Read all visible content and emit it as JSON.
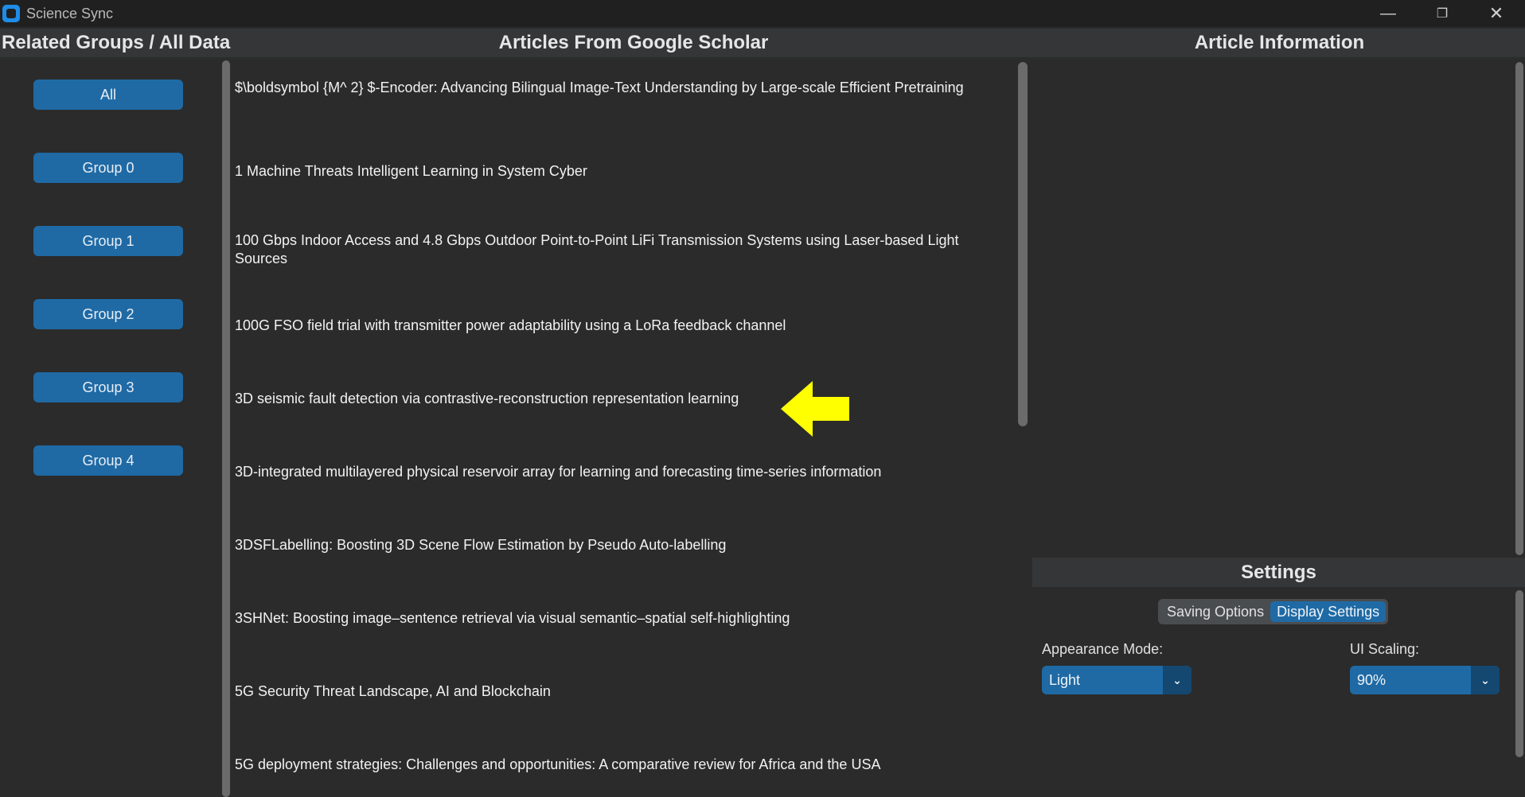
{
  "window": {
    "title": "Science Sync",
    "minimize_glyph": "—",
    "maximize_glyph": "❐",
    "close_glyph": "✕"
  },
  "panels": {
    "left_title": "Related Groups / All Data",
    "middle_title": "Articles From Google Scholar",
    "right_title": "Article Information"
  },
  "groups": [
    {
      "label": "All"
    },
    {
      "label": "Group 0"
    },
    {
      "label": "Group 1"
    },
    {
      "label": "Group 2"
    },
    {
      "label": "Group 3"
    },
    {
      "label": "Group 4"
    }
  ],
  "articles": [
    {
      "title": "$\\boldsymbol {M^ 2} $-Encoder: Advancing Bilingual Image-Text Understanding by Large-scale Efficient Pretraining"
    },
    {
      "title": "1 Machine Threats Intelligent Learning in System Cyber"
    },
    {
      "title": "100 Gbps Indoor Access and 4.8 Gbps Outdoor Point-to-Point LiFi Transmission Systems using Laser-based Light Sources"
    },
    {
      "title": "100G FSO field trial with transmitter power adaptability using a LoRa feedback channel"
    },
    {
      "title": "3D seismic fault detection via contrastive-reconstruction representation learning"
    },
    {
      "title": "3D-integrated multilayered physical reservoir array for learning and forecasting time-series information"
    },
    {
      "title": "3DSFLabelling: Boosting 3D Scene Flow Estimation by Pseudo Auto-labelling"
    },
    {
      "title": "3SHNet: Boosting image–sentence retrieval via visual semantic–spatial self-highlighting"
    },
    {
      "title": "5G Security Threat Landscape, AI and Blockchain"
    },
    {
      "title": "5G deployment strategies: Challenges and opportunities: A comparative review for Africa and the USA"
    }
  ],
  "settings": {
    "title": "Settings",
    "tabs": [
      {
        "label": "Saving Options",
        "active": false
      },
      {
        "label": "Display Settings",
        "active": true
      }
    ],
    "appearance_label": "Appearance Mode:",
    "appearance_value": "Light",
    "scaling_label": "UI Scaling:",
    "scaling_value": "90%"
  },
  "annotation": {
    "arrow_color": "#ffff00"
  },
  "colors": {
    "accent": "#1f6aa5",
    "accent_dark": "#144870",
    "background": "#2b2b2b",
    "header": "#343638"
  }
}
